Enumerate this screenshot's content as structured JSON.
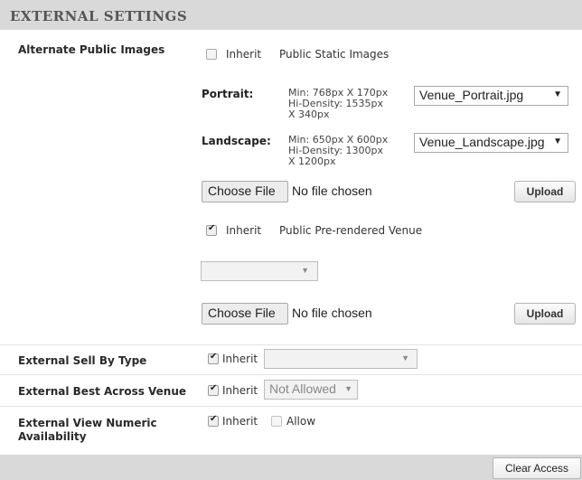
{
  "section": {
    "title": "EXTERNAL SETTINGS"
  },
  "alt_images": {
    "label": "Alternate Public Images",
    "static": {
      "inherit_label": "Inherit",
      "inherit_checked": false,
      "caption": "Public Static Images"
    },
    "portrait": {
      "label": "Portrait:",
      "spec_line1": "Min: 768px X 170px",
      "spec_line2": "Hi-Density: 1535px",
      "spec_line3": "X 340px",
      "selected": "Venue_Portrait.jpg"
    },
    "landscape": {
      "label": "Landscape:",
      "spec_line1": "Min: 650px X 600px",
      "spec_line2": "Hi-Density: 1300px",
      "spec_line3": "X 1200px",
      "selected": "Venue_Landscape.jpg"
    },
    "file1": {
      "button": "Choose File",
      "status": "No file chosen",
      "upload": "Upload"
    },
    "prerendered": {
      "inherit_label": "Inherit",
      "inherit_checked": true,
      "caption": "Public Pre-rendered Venue",
      "selected": ""
    },
    "file2": {
      "button": "Choose File",
      "status": "No file chosen",
      "upload": "Upload"
    }
  },
  "sell_by_type": {
    "label": "External Sell By Type",
    "inherit_label": "Inherit",
    "inherit_checked": true,
    "selected": ""
  },
  "best_across": {
    "label": "External Best Across Venue",
    "inherit_label": "Inherit",
    "inherit_checked": true,
    "selected": "Not Allowed"
  },
  "view_numeric": {
    "label_line1": "External View Numeric",
    "label_line2": "Availability",
    "inherit_label": "Inherit",
    "inherit_checked": true,
    "allow_label": "Allow",
    "allow_checked": false
  },
  "footer": {
    "clear_button": "Clear Access"
  },
  "icons": {
    "checkmark": "check-icon",
    "dropdown": "chevron-down-icon"
  }
}
